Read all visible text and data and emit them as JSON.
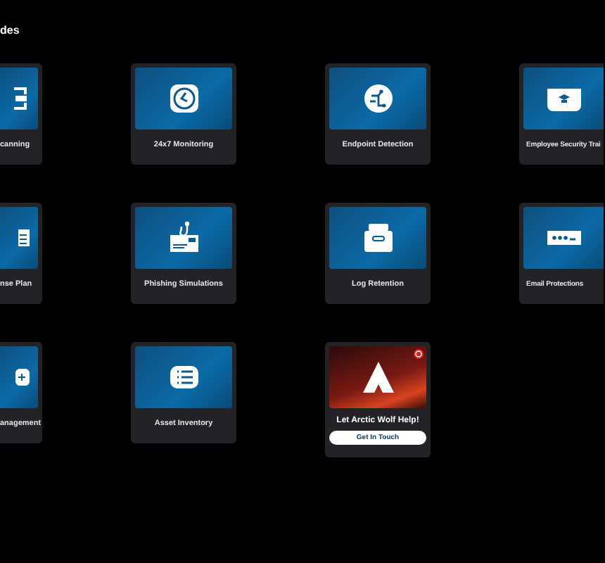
{
  "heading": "des",
  "tiles": [
    {
      "kind": "cut-left",
      "label": "canning"
    },
    {
      "kind": "service",
      "label": "24x7 Monitoring"
    },
    {
      "kind": "service",
      "label": "Endpoint Detection"
    },
    {
      "kind": "cut-right",
      "label": "Employee Security Trai"
    },
    {
      "kind": "cut-left",
      "label": "nse Plan"
    },
    {
      "kind": "service",
      "label": "Phishing Simulations"
    },
    {
      "kind": "service",
      "label": "Log Retention"
    },
    {
      "kind": "cut-right",
      "label": "Email Protections"
    },
    {
      "kind": "cut-left",
      "label": "anagement"
    },
    {
      "kind": "service",
      "label": "Asset Inventory"
    },
    {
      "kind": "promo",
      "label": "Let Arctic Wolf Help!",
      "button": "Get In Touch"
    }
  ]
}
